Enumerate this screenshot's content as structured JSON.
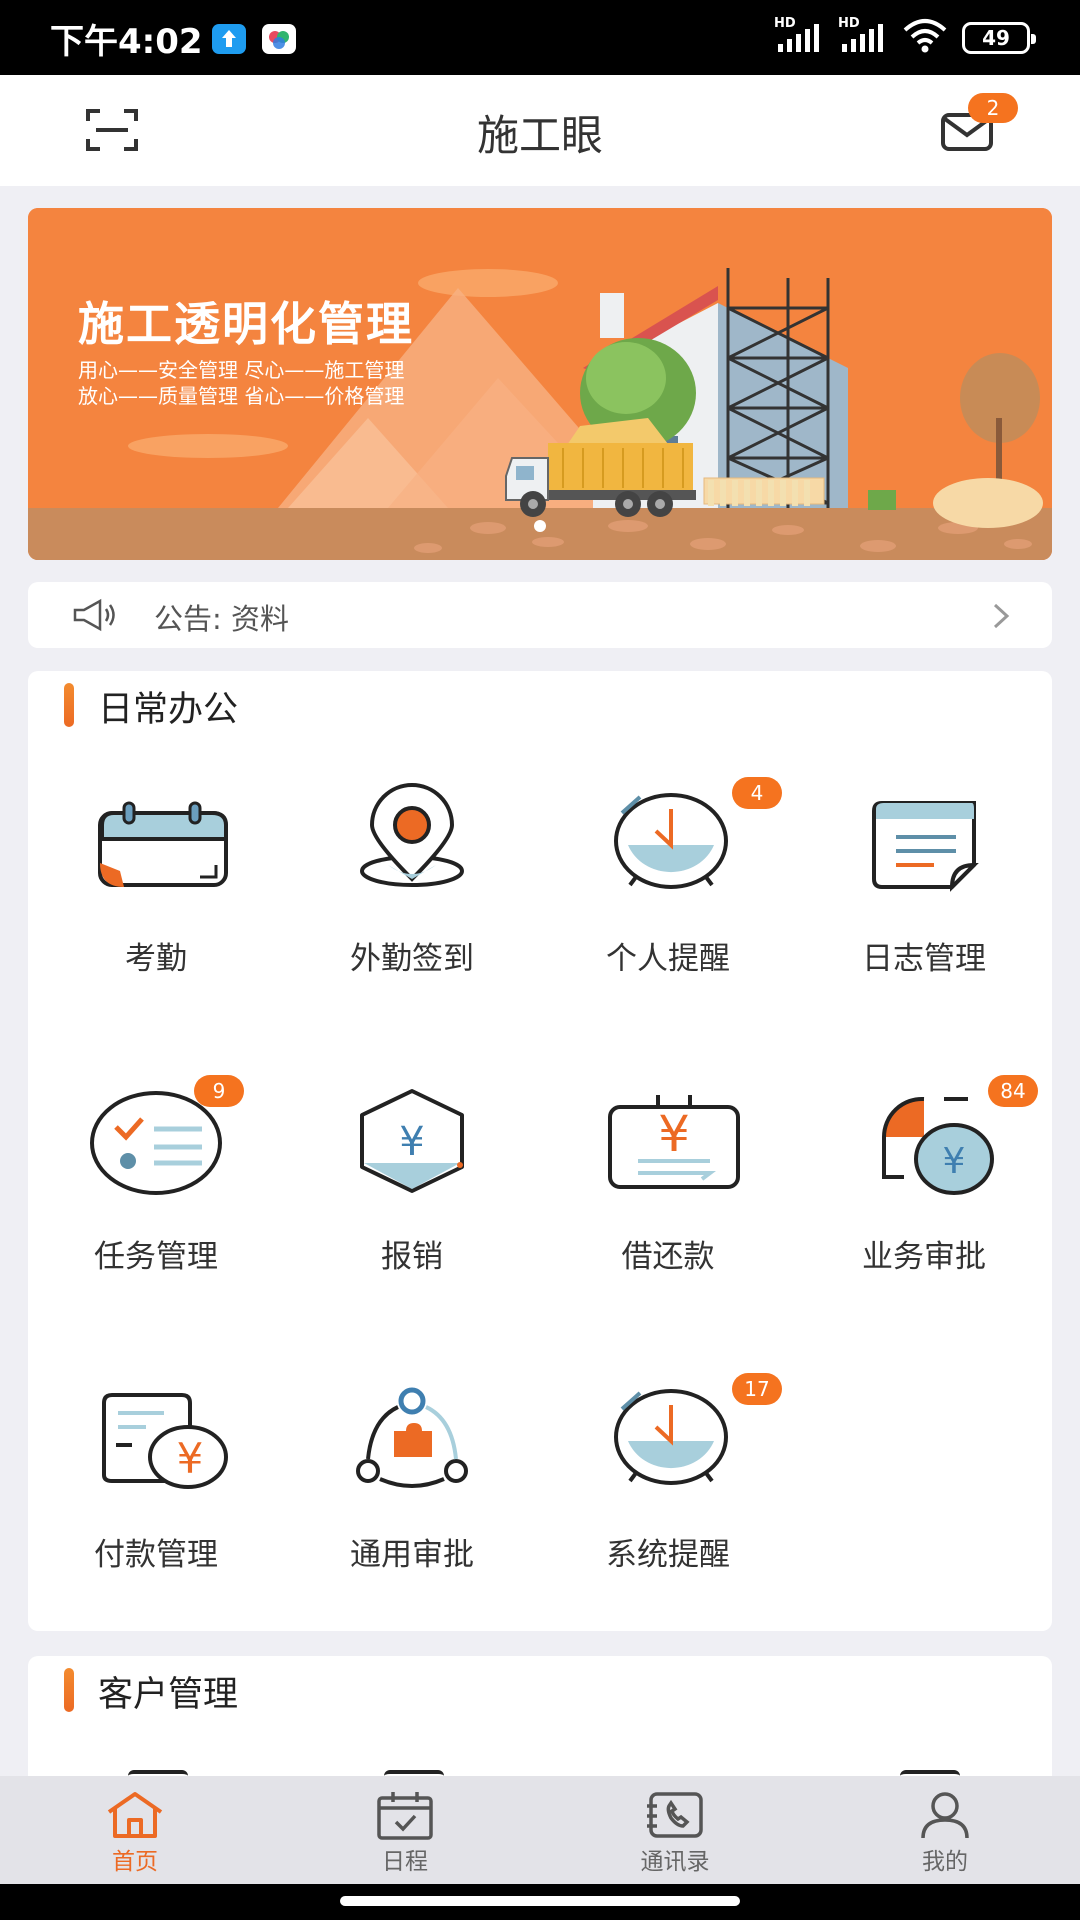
{
  "status_bar": {
    "time": "下午4:02",
    "signal1": "HD",
    "signal2": "HD",
    "battery": "49"
  },
  "header": {
    "title": "施工眼",
    "mail_badge": "2"
  },
  "banner": {
    "title": "施工透明化管理",
    "line1": "用心——安全管理  尽心——施工管理",
    "line2": "放心——质量管理  省心——价格管理"
  },
  "notice": {
    "text": "公告: 资料"
  },
  "daily_office": {
    "title": "日常办公",
    "items": [
      {
        "label": "考勤",
        "icon": "calendar-icon"
      },
      {
        "label": "外勤签到",
        "icon": "location-pin-icon"
      },
      {
        "label": "个人提醒",
        "icon": "alarm-clock-icon",
        "badge": "4"
      },
      {
        "label": "日志管理",
        "icon": "log-document-icon"
      },
      {
        "label": "任务管理",
        "icon": "task-list-icon",
        "badge": "9"
      },
      {
        "label": "报销",
        "icon": "yen-hexagon-icon"
      },
      {
        "label": "借还款",
        "icon": "yen-transfer-icon"
      },
      {
        "label": "业务审批",
        "icon": "business-approval-icon",
        "badge": "84"
      },
      {
        "label": "付款管理",
        "icon": "payment-document-icon"
      },
      {
        "label": "通用审批",
        "icon": "workflow-icon"
      },
      {
        "label": "系统提醒",
        "icon": "alarm-clock-icon",
        "badge": "17"
      }
    ]
  },
  "customer": {
    "title": "客户管理"
  },
  "tab_bar": {
    "tabs": [
      {
        "label": "首页",
        "icon": "home-icon",
        "active": true
      },
      {
        "label": "日程",
        "icon": "calendar-check-icon"
      },
      {
        "label": "通讯录",
        "icon": "contacts-phone-icon"
      },
      {
        "label": "我的",
        "icon": "person-icon"
      }
    ]
  },
  "colors": {
    "accent": "#ec6a24",
    "banner": "#f4843f",
    "icon_blue": "#a8cfdc",
    "icon_dark": "#222222"
  }
}
